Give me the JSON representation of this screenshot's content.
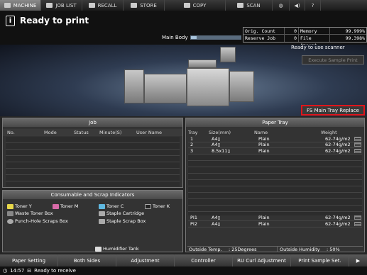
{
  "nav": {
    "tabs": [
      {
        "label": "MACHINE",
        "icon": "machine-icon"
      },
      {
        "label": "JOB LIST",
        "icon": "job-list-icon"
      },
      {
        "label": "RECALL",
        "icon": "recall-icon"
      },
      {
        "label": "STORE",
        "icon": "store-icon"
      },
      {
        "label": "COPY",
        "icon": "copy-icon"
      },
      {
        "label": "SCAN",
        "icon": "scan-icon"
      }
    ],
    "active_tab": "MACHINE"
  },
  "header": {
    "status_title": "Ready to print",
    "main_body_label": "Main Body",
    "main_body_level": 0.12,
    "ready_to_use": "Ready to use scanner"
  },
  "counters": {
    "orig_count_label": "Orig. Count",
    "orig_count": "0",
    "memory_label": "Memory",
    "memory": "99.999%",
    "reserve_job_label": "Reserve Job",
    "reserve_job": "0",
    "file_amount_label": "File Amount",
    "file_amount": "99.398%"
  },
  "buttons": {
    "execute_sample_print": "Execute Sample Print",
    "fs_main_tray_replace": "FS Main Tray Replace"
  },
  "job": {
    "title": "Job",
    "columns": [
      "No.",
      "Mode",
      "Status",
      "Minute(S)",
      "User Name"
    ]
  },
  "consumables": {
    "title": "Consumable and Scrap Indicators",
    "items": {
      "toner_y": "Toner Y",
      "toner_m": "Toner M",
      "toner_c": "Toner C",
      "toner_k": "Toner K",
      "waste_toner": "Waste Toner Box",
      "staple_cartridge": "Staple Cartridge",
      "punch_hole": "Punch-Hole Scraps Box",
      "staple_scrap": "Staple Scrap Box",
      "humidifier": "Humidifier Tank"
    },
    "colors": {
      "y": "#e8d84a",
      "m": "#d86aa8",
      "c": "#5fb8e0",
      "k": "#222222"
    }
  },
  "paper_tray": {
    "title": "Paper Tray",
    "columns": [
      "Tray",
      "Size(mm)",
      "Name",
      "Weight"
    ],
    "rows": [
      {
        "tray": "1",
        "size": "A4▯",
        "name": "Plain",
        "weight": "62-74g/m2"
      },
      {
        "tray": "2",
        "size": "A4▯",
        "name": "Plain",
        "weight": "62-74g/m2"
      },
      {
        "tray": "3",
        "size": "8.5x11▯",
        "name": "Plain",
        "weight": "62-74g/m2"
      }
    ],
    "pi_rows": [
      {
        "tray": "PI1",
        "size": "A4▯",
        "name": "Plain",
        "weight": "62-74g/m2"
      },
      {
        "tray": "PI2",
        "size": "A4▯",
        "name": "Plain",
        "weight": "62-74g/m2"
      }
    ],
    "outside_temp_label": "Outside Temp.",
    "outside_temp": ": 25Degrees",
    "outside_humidity_label": "Outside Humidity",
    "outside_humidity": ": 50%"
  },
  "bottom": {
    "buttons": [
      "Paper Setting",
      "Both Sides",
      "Adjustment",
      "Controller",
      "RU Curl Adjustment",
      "Print Sample Set.",
      "▶"
    ],
    "time": "14:57",
    "status": "Ready to receive"
  }
}
